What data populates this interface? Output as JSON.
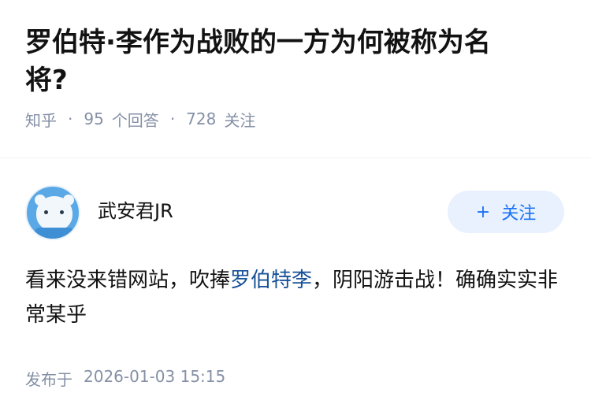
{
  "question": {
    "title": "罗伯特·李作为战败的一方为何被称为名将?",
    "source": "知乎",
    "answer_count": "95",
    "answer_label": "个回答",
    "follow_count": "728",
    "follow_label": "关注"
  },
  "answer": {
    "author_name": "武安君JR",
    "follow_button_label": "关注",
    "follow_button_icon": "plus-icon",
    "content_before": "看来没来错网站，吹捧",
    "content_link": "罗伯特李",
    "content_after": "，阴阳游击战！确确实实非常某乎",
    "publish_label": "发布于",
    "publish_time": "2026-01-03 15:15"
  },
  "colors": {
    "accent": "#1772f6",
    "link": "#175199",
    "muted": "#8590a6",
    "follow_bg": "#e8f1fd"
  }
}
